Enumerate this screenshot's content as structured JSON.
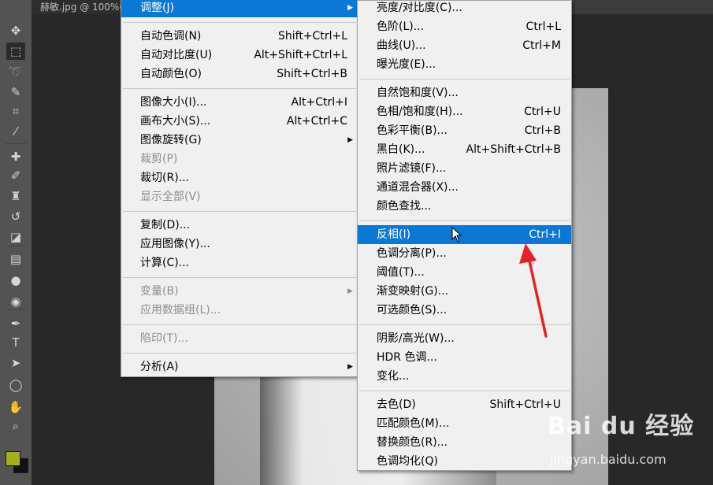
{
  "document": {
    "tab_title": "赫敏.jpg @ 100%("
  },
  "tools": [
    {
      "icon": "move-icon",
      "glyph": "✥"
    },
    {
      "icon": "marquee-icon",
      "glyph": "⬚"
    },
    {
      "icon": "lasso-icon",
      "glyph": "➰"
    },
    {
      "icon": "quick-select-icon",
      "glyph": "✎"
    },
    {
      "icon": "crop-icon",
      "glyph": "⌗"
    },
    {
      "icon": "eyedropper-icon",
      "glyph": "⁄"
    },
    {
      "icon": "healing-brush-icon",
      "glyph": "✚"
    },
    {
      "icon": "brush-icon",
      "glyph": "✐"
    },
    {
      "icon": "clone-stamp-icon",
      "glyph": "♜"
    },
    {
      "icon": "history-brush-icon",
      "glyph": "↺"
    },
    {
      "icon": "eraser-icon",
      "glyph": "◪"
    },
    {
      "icon": "gradient-icon",
      "glyph": "▤"
    },
    {
      "icon": "blur-icon",
      "glyph": "●"
    },
    {
      "icon": "dodge-icon",
      "glyph": "◉"
    },
    {
      "icon": "pen-icon",
      "glyph": "✒"
    },
    {
      "icon": "type-icon",
      "glyph": "T"
    },
    {
      "icon": "path-select-icon",
      "glyph": "➤"
    },
    {
      "icon": "ellipse-icon",
      "glyph": "◯"
    },
    {
      "icon": "hand-icon",
      "glyph": "✋"
    },
    {
      "icon": "zoom-icon",
      "glyph": "⌕"
    }
  ],
  "colors": {
    "foreground": "#a3b01b",
    "background": "#111111",
    "highlight": "#0a78d4",
    "annotation_arrow": "#e8222a"
  },
  "image_menu": [
    {
      "label": "调整(J)",
      "shortcut": "",
      "submenu": true,
      "selected": true
    },
    {
      "sep": true
    },
    {
      "label": "自动色调(N)",
      "shortcut": "Shift+Ctrl+L"
    },
    {
      "label": "自动对比度(U)",
      "shortcut": "Alt+Shift+Ctrl+L"
    },
    {
      "label": "自动颜色(O)",
      "shortcut": "Shift+Ctrl+B"
    },
    {
      "sep": true
    },
    {
      "label": "图像大小(I)...",
      "shortcut": "Alt+Ctrl+I"
    },
    {
      "label": "画布大小(S)...",
      "shortcut": "Alt+Ctrl+C"
    },
    {
      "label": "图像旋转(G)",
      "shortcut": "",
      "submenu": true
    },
    {
      "label": "裁剪(P)",
      "shortcut": "",
      "disabled": true
    },
    {
      "label": "裁切(R)...",
      "shortcut": ""
    },
    {
      "label": "显示全部(V)",
      "shortcut": "",
      "disabled": true
    },
    {
      "sep": true
    },
    {
      "label": "复制(D)...",
      "shortcut": ""
    },
    {
      "label": "应用图像(Y)...",
      "shortcut": ""
    },
    {
      "label": "计算(C)...",
      "shortcut": ""
    },
    {
      "sep": true
    },
    {
      "label": "变量(B)",
      "shortcut": "",
      "submenu": true,
      "disabled": true
    },
    {
      "label": "应用数据组(L)...",
      "shortcut": "",
      "disabled": true
    },
    {
      "sep": true
    },
    {
      "label": "陷印(T)...",
      "shortcut": "",
      "disabled": true
    },
    {
      "sep": true
    },
    {
      "label": "分析(A)",
      "shortcut": "",
      "submenu": true
    }
  ],
  "adjust_menu": [
    {
      "label": "亮度/对比度(C)...",
      "shortcut": ""
    },
    {
      "label": "色阶(L)...",
      "shortcut": "Ctrl+L"
    },
    {
      "label": "曲线(U)...",
      "shortcut": "Ctrl+M"
    },
    {
      "label": "曝光度(E)...",
      "shortcut": ""
    },
    {
      "sep": true
    },
    {
      "label": "自然饱和度(V)...",
      "shortcut": ""
    },
    {
      "label": "色相/饱和度(H)...",
      "shortcut": "Ctrl+U"
    },
    {
      "label": "色彩平衡(B)...",
      "shortcut": "Ctrl+B"
    },
    {
      "label": "黑白(K)...",
      "shortcut": "Alt+Shift+Ctrl+B"
    },
    {
      "label": "照片滤镜(F)...",
      "shortcut": ""
    },
    {
      "label": "通道混合器(X)...",
      "shortcut": ""
    },
    {
      "label": "颜色查找...",
      "shortcut": ""
    },
    {
      "sep": true
    },
    {
      "label": "反相(I)",
      "shortcut": "Ctrl+I",
      "selected": true
    },
    {
      "label": "色调分离(P)...",
      "shortcut": ""
    },
    {
      "label": "阈值(T)...",
      "shortcut": ""
    },
    {
      "label": "渐变映射(G)...",
      "shortcut": ""
    },
    {
      "label": "可选颜色(S)...",
      "shortcut": ""
    },
    {
      "sep": true
    },
    {
      "label": "阴影/高光(W)...",
      "shortcut": ""
    },
    {
      "label": "HDR 色调...",
      "shortcut": ""
    },
    {
      "label": "变化...",
      "shortcut": ""
    },
    {
      "sep": true
    },
    {
      "label": "去色(D)",
      "shortcut": "Shift+Ctrl+U"
    },
    {
      "label": "匹配颜色(M)...",
      "shortcut": ""
    },
    {
      "label": "替换颜色(R)...",
      "shortcut": ""
    },
    {
      "label": "色调均化(Q)",
      "shortcut": ""
    }
  ],
  "watermark": {
    "brand": "Bai du 经验",
    "url": "jingyan.baidu.com"
  }
}
